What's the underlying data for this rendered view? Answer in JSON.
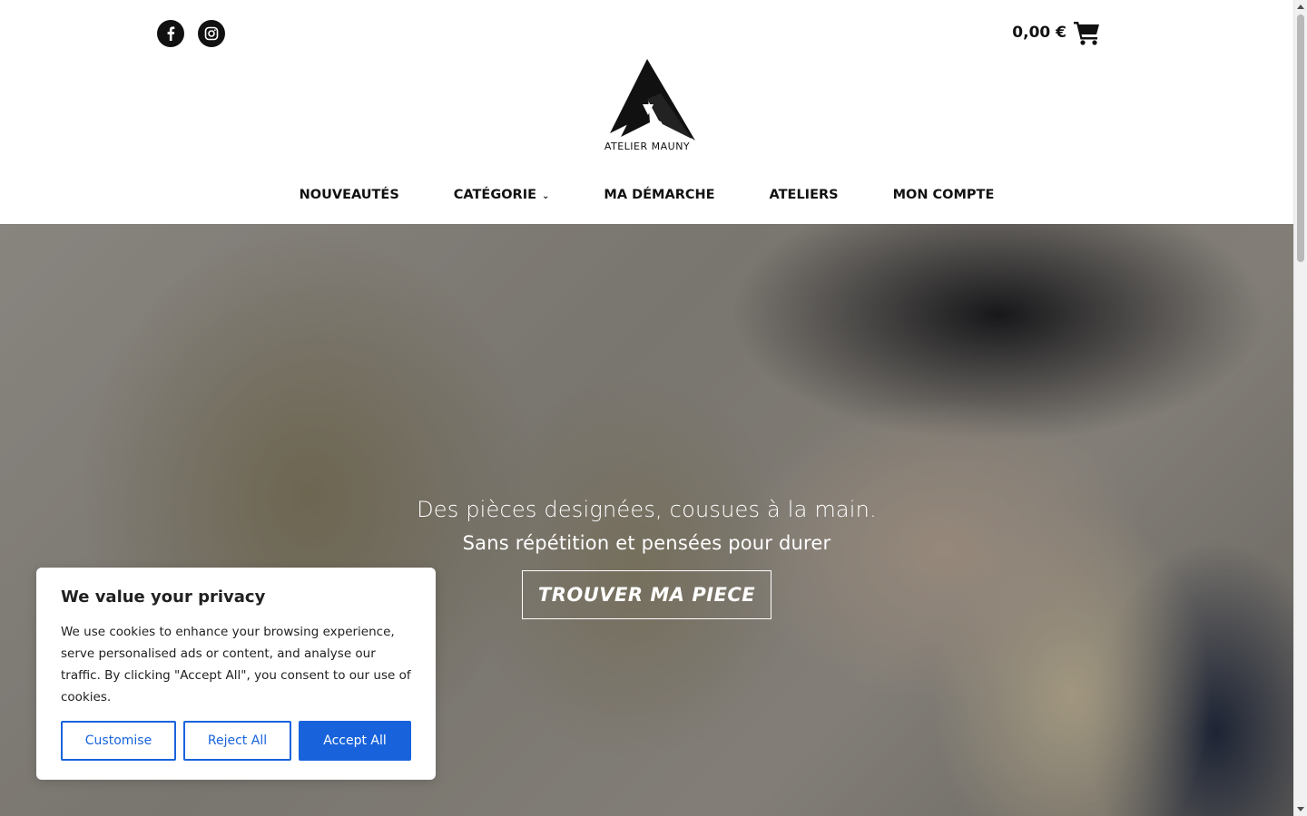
{
  "header": {
    "social": [
      {
        "icon": "facebook-icon"
      },
      {
        "icon": "instagram-icon"
      }
    ],
    "cart_total": "0,00 €",
    "cart_icon": "shopping-cart-icon",
    "logo_text": "ATELIER MAUNY"
  },
  "nav": {
    "items": [
      {
        "label": "NOUVEAUTÉS"
      },
      {
        "label": "CATÉGORIE",
        "chevron": "⌄"
      },
      {
        "label": "MA DÉMARCHE"
      },
      {
        "label": "ATELIERS"
      },
      {
        "label": "MON COMPTE"
      }
    ]
  },
  "hero": {
    "line1": "Des pièces designées, cousues à la main.",
    "line2": "Sans répétition et pensées pour durer",
    "button": "TROUVER MA PIECE"
  },
  "cookie": {
    "title": "We value your privacy",
    "text": "We use cookies to enhance your browsing experience, serve personalised ads or content, and analyse our traffic. By clicking \"Accept All\", you consent to our use of cookies.",
    "customise": "Customise",
    "reject": "Reject All",
    "accept": "Accept All",
    "accent_color": "#1863dc"
  }
}
